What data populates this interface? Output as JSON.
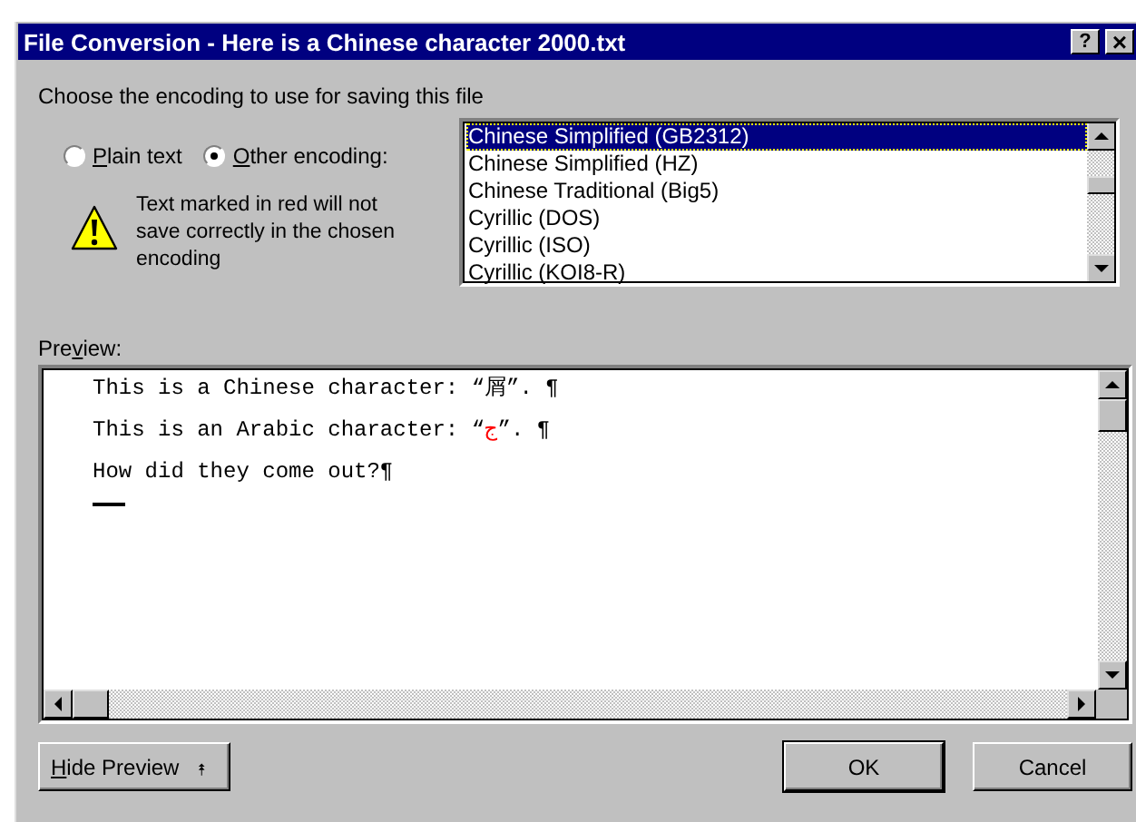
{
  "window": {
    "title": "File Conversion - Here is a Chinese character 2000.txt",
    "buttons": [
      {
        "kind": "help",
        "label": "?"
      },
      {
        "kind": "close",
        "label": "×"
      }
    ]
  },
  "instruction": "Choose the encoding to use for saving this file",
  "radios": [
    {
      "label": [
        {
          "text": "P",
          "underlined": true
        },
        {
          "text": "lain text",
          "underlined": false
        }
      ],
      "selected": false
    },
    {
      "label": [
        {
          "text": "O",
          "underlined": true
        },
        {
          "text": "ther encoding:",
          "underlined": false
        }
      ],
      "selected": true
    }
  ],
  "warning": "Text marked in red will not save correctly in the chosen encoding",
  "encodings": [
    {
      "label": "Chinese Simplified (GB2312)",
      "selected": true
    },
    {
      "label": "Chinese Simplified (HZ)",
      "selected": false
    },
    {
      "label": "Chinese Traditional (Big5)",
      "selected": false
    },
    {
      "label": "Cyrillic (DOS)",
      "selected": false
    },
    {
      "label": "Cyrillic (ISO)",
      "selected": false
    },
    {
      "label": "Cyrillic (KOI8-R)",
      "selected": false
    }
  ],
  "preview": {
    "label": [
      {
        "text": "Pre",
        "underlined": false
      },
      {
        "text": "v",
        "underlined": true
      },
      {
        "text": "iew:",
        "underlined": false
      }
    ],
    "lines": [
      {
        "segments": [
          {
            "text": "This is a Chinese character: “屑”. ¶",
            "unsaveable": false
          }
        ]
      },
      {
        "segments": [
          {
            "text": "This is an Arabic character: “",
            "unsaveable": false
          },
          {
            "text": "ج",
            "unsaveable": true
          },
          {
            "text": "”. ¶",
            "unsaveable": false
          }
        ]
      },
      {
        "segments": [
          {
            "text": "How did they come out?¶",
            "unsaveable": false
          }
        ]
      }
    ]
  },
  "buttons": [
    {
      "kind": "toggle",
      "label": [
        {
          "text": "H",
          "underlined": true
        },
        {
          "text": "ide Preview",
          "underlined": false
        }
      ],
      "icon": "⯭"
    },
    {
      "kind": "ok",
      "label": "OK"
    },
    {
      "kind": "cancel",
      "label": "Cancel"
    }
  ]
}
